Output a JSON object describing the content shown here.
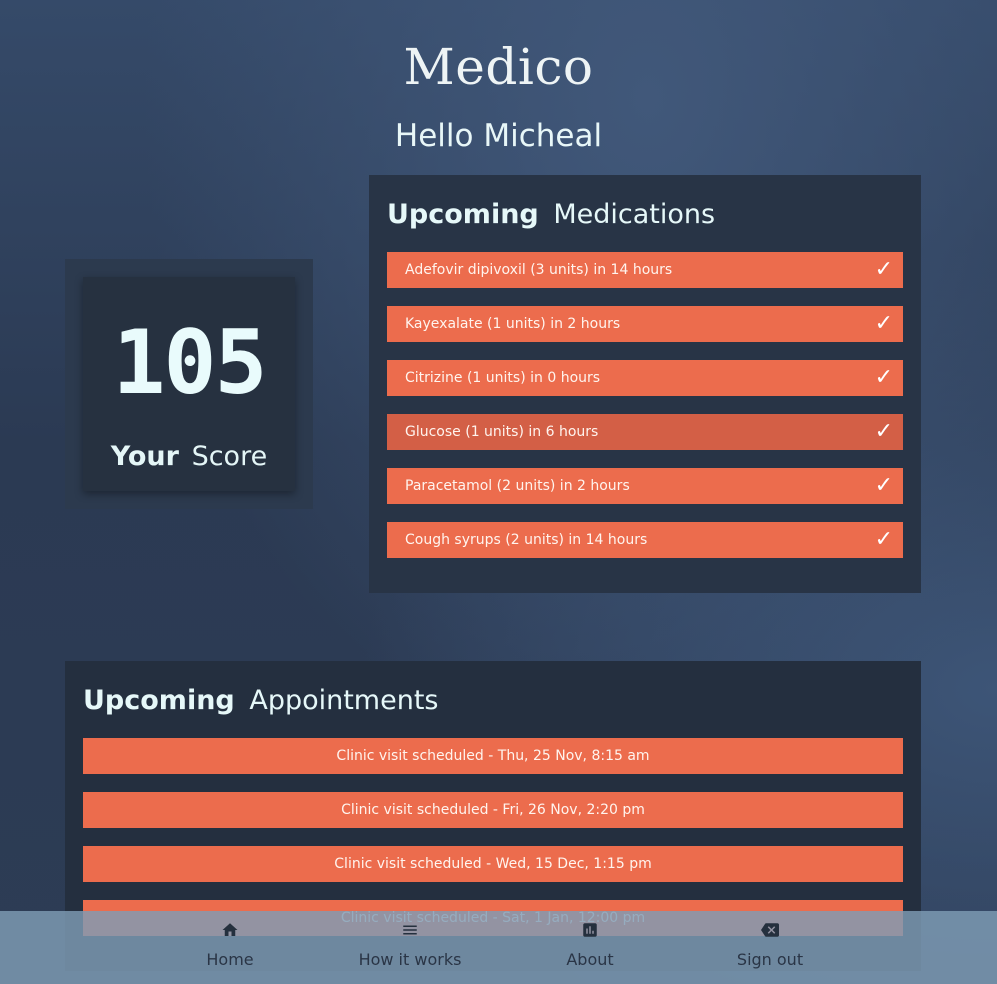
{
  "app": {
    "brand": "Medico",
    "greeting": "Hello Micheal"
  },
  "score": {
    "value": "105",
    "label_bold": "Your",
    "label_rest": "Score"
  },
  "medications": {
    "title_bold": "Upcoming",
    "title_rest": "Medications",
    "check_glyph": "✓",
    "items": [
      "Adefovir dipivoxil (3 units) in 14 hours",
      "Kayexalate (1 units) in 2 hours",
      "Citrizine (1 units) in 0 hours",
      "Glucose (1 units) in 6 hours",
      "Paracetamol (2 units) in 2 hours",
      "Cough syrups (2 units) in 14 hours"
    ]
  },
  "appointments": {
    "title_bold": "Upcoming",
    "title_rest": "Appointments",
    "items": [
      "Clinic visit scheduled - Thu, 25 Nov, 8:15 am",
      "Clinic visit scheduled - Fri, 26 Nov, 2:20 pm",
      "Clinic visit scheduled - Wed, 15 Dec, 1:15 pm",
      "Clinic visit scheduled - Sat, 1 Jan, 12:00 pm"
    ]
  },
  "nav": {
    "items": [
      {
        "label": "Home",
        "icon": "home-icon"
      },
      {
        "label": "How it works",
        "icon": "menu-icon"
      },
      {
        "label": "About",
        "icon": "bar-chart-icon"
      },
      {
        "label": "Sign out",
        "icon": "backspace-icon"
      }
    ]
  },
  "colors": {
    "accent": "#ec6c4d",
    "accent_active": "#d35f46",
    "panel": "#283446",
    "nav_bg": "#7f9cb4"
  }
}
